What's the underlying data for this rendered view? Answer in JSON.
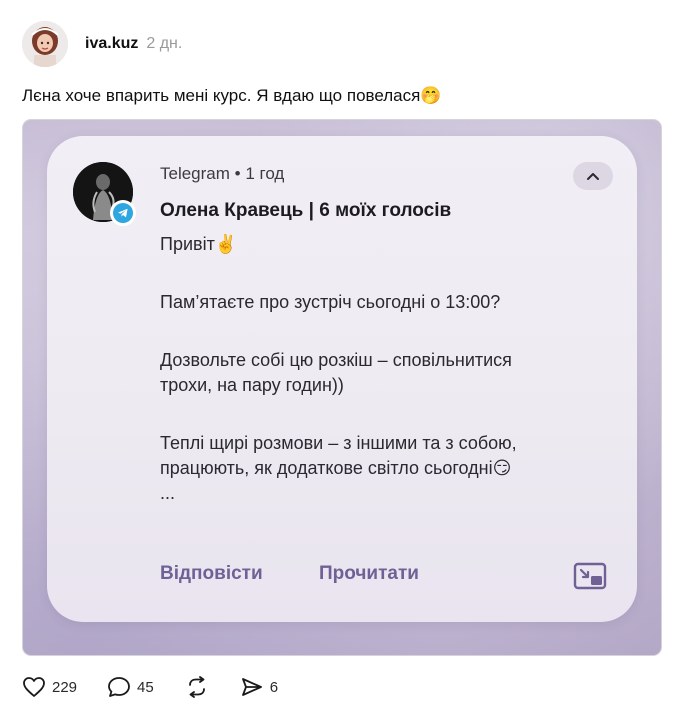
{
  "post": {
    "author": "iva.kuz",
    "time": "2 дн.",
    "text": "Лєна хоче впарить мені курс. Я вдаю що повелася🤭"
  },
  "notification": {
    "app_line": "Telegram • 1 год",
    "sender": "Олена Кравець | 6 моїх голосів",
    "lines": [
      "Привіт✌️",
      "Пам’ятаєте про зустріч сьогодні о 13:00?",
      "Дозвольте собі цю розкіш – сповільнитися",
      "трохи, на пару годин))",
      "Теплі щирі розмови – з іншими та з собою,",
      "працюють, як додаткове світло сьогодні😏",
      "..."
    ],
    "reply_label": "Відповісти",
    "read_label": "Прочитати",
    "accent_color": "#6f6195",
    "badge_color": "#2ea6e0"
  },
  "stats": {
    "likes": "229",
    "comments": "45",
    "shares": "6"
  }
}
